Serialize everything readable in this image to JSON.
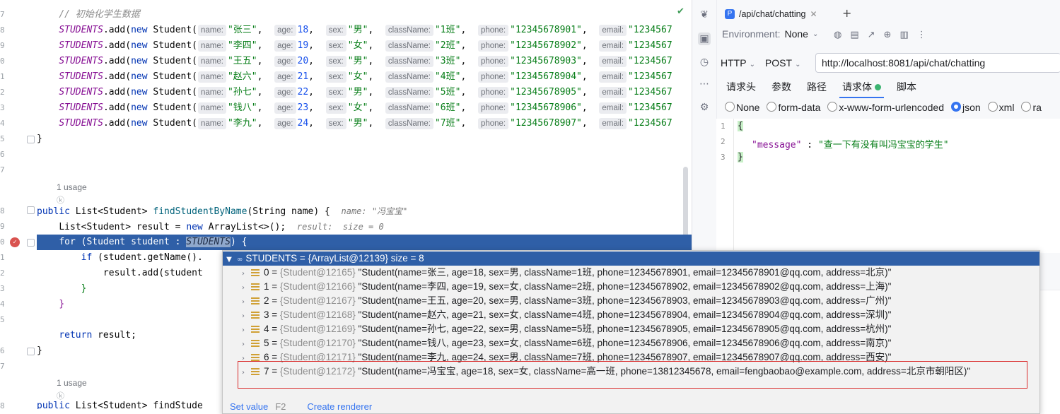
{
  "editor": {
    "line_numbers": [
      "7",
      "8",
      "9",
      "0",
      "1",
      "2",
      "3",
      "4",
      "5",
      "6",
      "7",
      "",
      "",
      "8",
      "9",
      "0",
      "1",
      "2",
      "3",
      "4",
      "5",
      "",
      "6",
      "7",
      "",
      "8"
    ],
    "comment": "// 初始化学生数据",
    "students": [
      {
        "name": "\"张三\"",
        "age": "18",
        "sex": "\"男\"",
        "className": "\"1班\"",
        "phone": "\"12345678901\"",
        "email": "\"1234567"
      },
      {
        "name": "\"李四\"",
        "age": "19",
        "sex": "\"女\"",
        "className": "\"2班\"",
        "phone": "\"12345678902\"",
        "email": "\"1234567"
      },
      {
        "name": "\"王五\"",
        "age": "20",
        "sex": "\"男\"",
        "className": "\"3班\"",
        "phone": "\"12345678903\"",
        "email": "\"1234567"
      },
      {
        "name": "\"赵六\"",
        "age": "21",
        "sex": "\"女\"",
        "className": "\"4班\"",
        "phone": "\"12345678904\"",
        "email": "\"1234567"
      },
      {
        "name": "\"孙七\"",
        "age": "22",
        "sex": "\"男\"",
        "className": "\"5班\"",
        "phone": "\"12345678905\"",
        "email": "\"1234567"
      },
      {
        "name": "\"钱八\"",
        "age": "23",
        "sex": "\"女\"",
        "className": "\"6班\"",
        "phone": "\"12345678906\"",
        "email": "\"1234567"
      },
      {
        "name": "\"李九\"",
        "age": "24",
        "sex": "\"男\"",
        "className": "\"7班\"",
        "phone": "\"12345678907\"",
        "email": "\"1234567"
      }
    ],
    "hint_labels": {
      "name": "name:",
      "age": "age:",
      "sex": "sex:",
      "className": "className:",
      "phone": "phone:",
      "email": "email:"
    },
    "code": {
      "students_const": "STUDENTS",
      "add_call": ".add(",
      "new_kw": "new",
      "student_ctor": " Student(",
      "close_brace": "}",
      "usage1": "1 usage",
      "usage2": "1 usage",
      "author_glyph": "ⓚ",
      "method_sig_kw": "public",
      "method_sig_type": " List<Student> ",
      "method_name": "findStudentByName",
      "method_params": "(String name) {",
      "method_hint": "name: \"冯宝宝\"",
      "result_line": "List<Student> result = ",
      "result_new": "new",
      "result_tail": " ArrayList<>();",
      "result_hint": "result:  size = 0",
      "for_kw": "for",
      "for_head": " (Student student : ",
      "for_tail": ") {",
      "if_kw": "if",
      "if_head": " (student.getName().",
      "add_line": "result.add(student",
      "brace_inner": "}",
      "brace_outer": "}",
      "return_kw": "return",
      "return_tail": " result;",
      "brace_end": "}",
      "last_kw": "public",
      "last_tail": " List<Student> findStude"
    }
  },
  "http_client": {
    "tab_badge": "P",
    "tab_title": "/api/chat/chatting",
    "tab_close": "✕",
    "tab_add": "+",
    "environment_label": "Environment:",
    "environment_value": "None",
    "protocol": "HTTP",
    "method": "POST",
    "url": "http://localhost:8081/api/chat/chatting",
    "subtabs": [
      "请求头",
      "参数",
      "路径",
      "请求体",
      "脚本"
    ],
    "body_types": [
      "None",
      "form-data",
      "x-www-form-urlencoded",
      "json",
      "xml",
      "ra"
    ],
    "selected_body_type": "json",
    "body_lines": [
      "1",
      "2",
      "3"
    ],
    "body_open": "{",
    "body_key": "\"message\"",
    "body_colon": " : ",
    "body_value": "\"查一下有没有叫冯宝宝的学生\"",
    "body_close": "}"
  },
  "debug_popup": {
    "header": "STUDENTS = {ArrayList@12139}  size = 8",
    "items": [
      {
        "index": "0",
        "ref": "{Student@12165}",
        "value": "\"Student(name=张三, age=18, sex=男, className=1班, phone=12345678901, email=12345678901@qq.com, address=北京)\""
      },
      {
        "index": "1",
        "ref": "{Student@12166}",
        "value": "\"Student(name=李四, age=19, sex=女, className=2班, phone=12345678902, email=12345678902@qq.com, address=上海)\""
      },
      {
        "index": "2",
        "ref": "{Student@12167}",
        "value": "\"Student(name=王五, age=20, sex=男, className=3班, phone=12345678903, email=12345678903@qq.com, address=广州)\""
      },
      {
        "index": "3",
        "ref": "{Student@12168}",
        "value": "\"Student(name=赵六, age=21, sex=女, className=4班, phone=12345678904, email=12345678904@qq.com, address=深圳)\""
      },
      {
        "index": "4",
        "ref": "{Student@12169}",
        "value": "\"Student(name=孙七, age=22, sex=男, className=5班, phone=12345678905, email=12345678905@qq.com, address=杭州)\""
      },
      {
        "index": "5",
        "ref": "{Student@12170}",
        "value": "\"Student(name=钱八, age=23, sex=女, className=6班, phone=12345678906, email=12345678906@qq.com, address=南京)\""
      },
      {
        "index": "6",
        "ref": "{Student@12171}",
        "value": "\"Student(name=李九, age=24, sex=男, className=7班, phone=12345678907, email=12345678907@qq.com, address=西安)\""
      },
      {
        "index": "7",
        "ref": "{Student@12172}",
        "value": "\"Student(name=冯宝宝, age=18, sex=女, className=高一班, phone=13812345678, email=fengbaobao@example.com, address=北京市朝阳区)\""
      }
    ],
    "set_value": "Set value",
    "set_value_key": "F2",
    "create_renderer": "Create renderer"
  },
  "colors": {
    "selection": "#2f5fa7",
    "highlight_box": "#d92b2b",
    "accent": "#3574f0"
  }
}
